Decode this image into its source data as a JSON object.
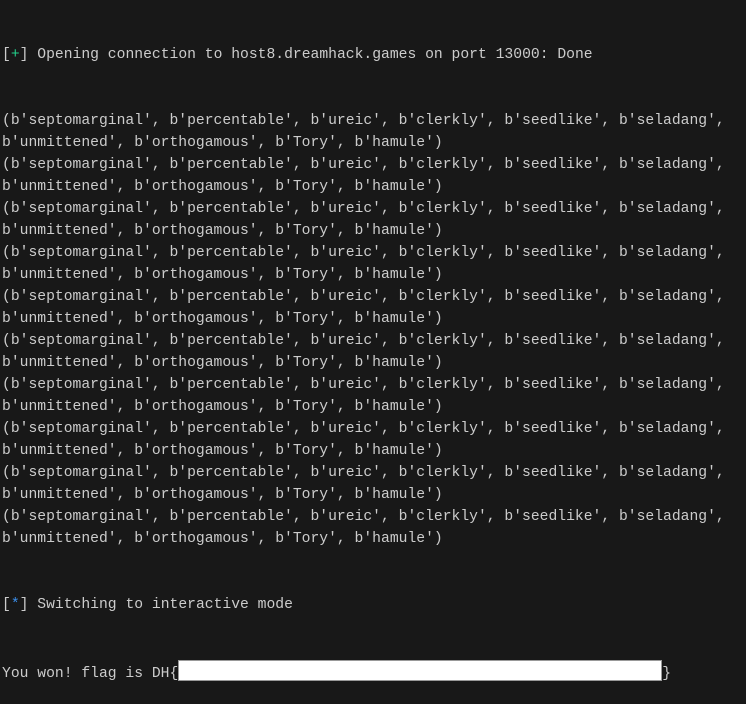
{
  "terminal": {
    "opening": {
      "bracket_open": "[",
      "marker": "+",
      "bracket_close": "]",
      "text": " Opening connection to host8.dreamhack.games on port 13000: Done"
    },
    "output_lines": [
      "(b'septomarginal', b'percentable', b'ureic', b'clerkly', b'seedlike', b'seladang',",
      "b'unmittened', b'orthogamous', b'Tory', b'hamule')"
    ],
    "repeat_count": 10,
    "interactive": {
      "bracket_open": "[",
      "marker": "*",
      "bracket_close": "]",
      "text": " Switching to interactive mode"
    },
    "flag_prefix": "You won! flag is DH{",
    "flag_suffix": "}",
    "colors": {
      "background": "#181818",
      "text": "#cccccc",
      "plus": "#23d18b",
      "star": "#3b8eea",
      "redaction": "#ffffff"
    }
  }
}
